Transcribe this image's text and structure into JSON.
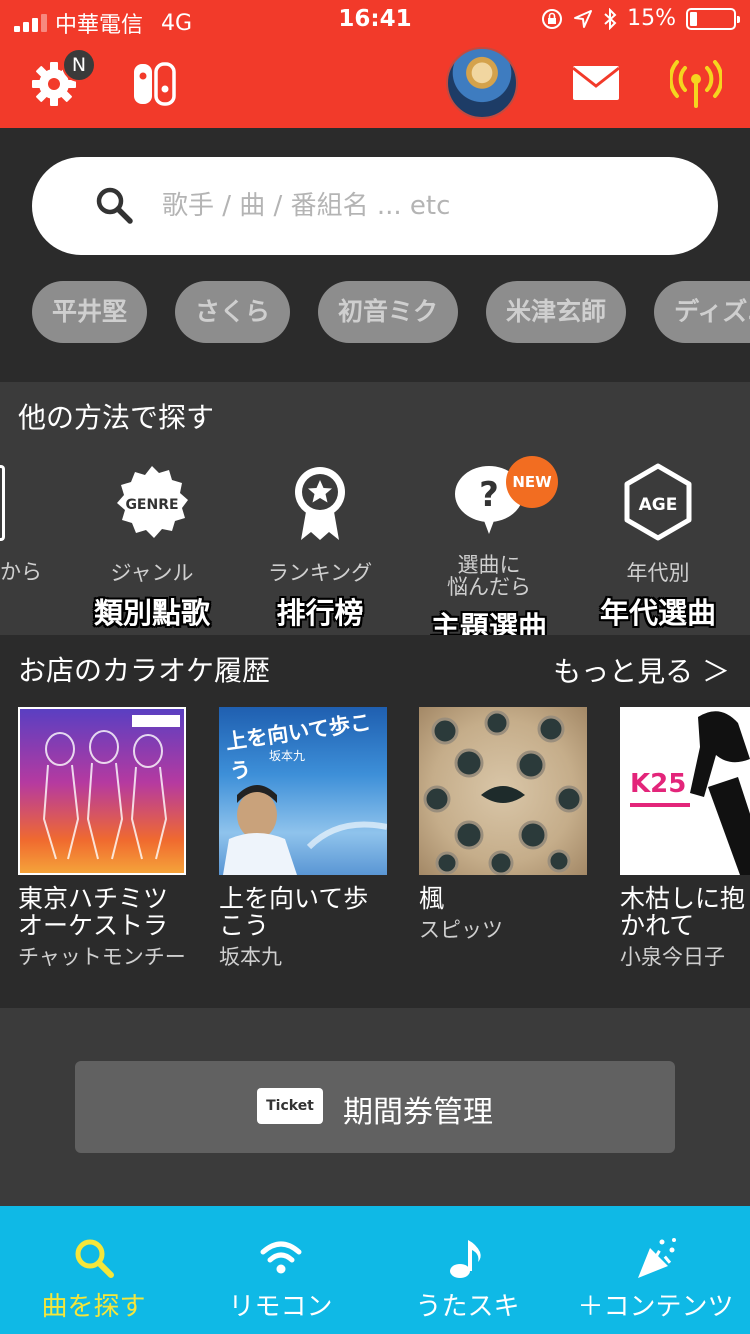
{
  "status_bar": {
    "carrier": "中華電信",
    "network": "4G",
    "time": "16:41",
    "battery": "15%"
  },
  "header": {
    "notification_badge": "N",
    "icons": [
      "gear-icon",
      "switch-console-icon",
      "avatar",
      "mail-icon",
      "antenna-icon"
    ],
    "accent_color": "#f23a2a"
  },
  "search": {
    "placeholder": "歌手 / 曲 / 番組名 ... etc",
    "chips": [
      "平井堅",
      "さくら",
      "初音ミク",
      "米津玄師",
      "ディズニー"
    ]
  },
  "methods": {
    "title": "他の方法で探す",
    "partial_label": "から",
    "new_badge": "NEW",
    "items": [
      {
        "label": "ジャンル",
        "label2": "",
        "sub": "類別點歌",
        "icon": "GENRE"
      },
      {
        "label": "ランキング",
        "label2": "",
        "sub": "排行榜",
        "icon": "ranking-icon"
      },
      {
        "label": "選曲に",
        "label2": "悩んだら",
        "sub": "主題選曲",
        "icon": "question-bubble-icon"
      },
      {
        "label": "年代別",
        "label2": "",
        "sub": "年代選曲",
        "icon": "AGE"
      }
    ]
  },
  "history": {
    "title": "お店のカラオケ履歴",
    "more": "もっと見る ＞",
    "albums": [
      {
        "title": "東京ハチミツオーケストラ",
        "artist": "チャットモンチー"
      },
      {
        "title": "上を向いて歩こう",
        "artist": "坂本九",
        "cover_text": "上を向いて歩こう"
      },
      {
        "title": "楓",
        "artist": "スピッツ"
      },
      {
        "title": "木枯しに抱かれて",
        "artist": "小泉今日子",
        "cover_text": "K25"
      }
    ]
  },
  "ticket": {
    "icon_text": "Ticket",
    "label": "期間券管理"
  },
  "tabbar": {
    "active_color": "#f5e63a",
    "tabs": [
      {
        "label": "曲を探す",
        "icon": "search-icon"
      },
      {
        "label": "リモコン",
        "icon": "wifi-icon"
      },
      {
        "label": "うたスキ",
        "icon": "music-note-icon"
      },
      {
        "label": "＋コンテンツ",
        "icon": "party-popper-icon"
      }
    ]
  }
}
